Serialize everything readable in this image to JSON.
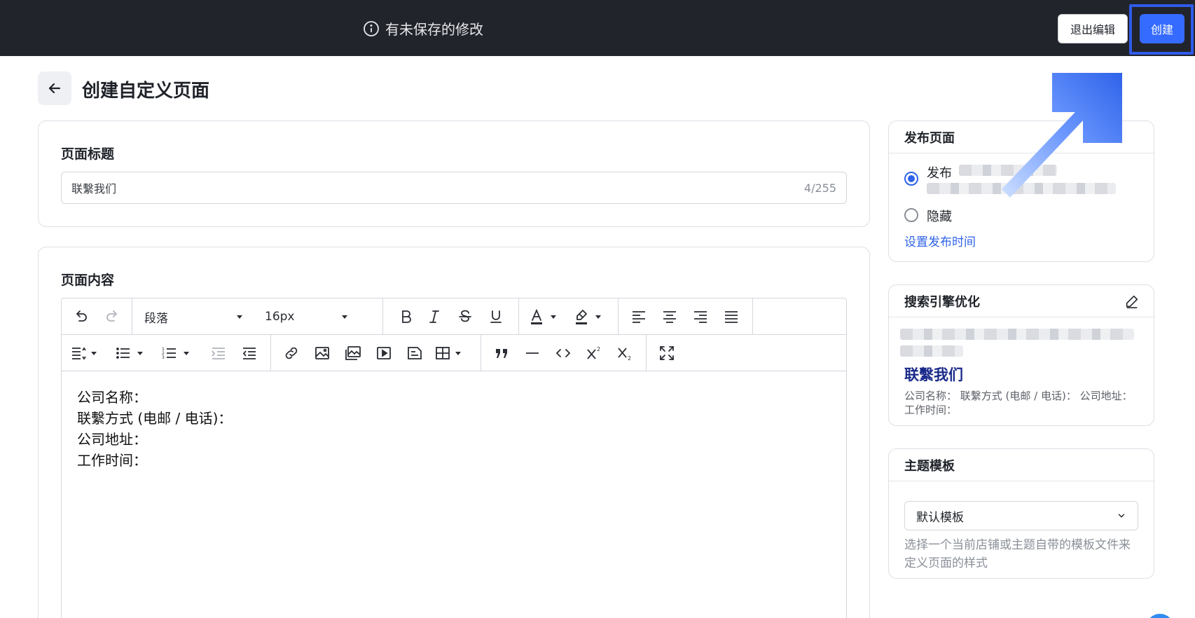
{
  "topbar": {
    "unsaved_text": "有未保存的修改",
    "exit_label": "退出编辑",
    "create_label": "创建"
  },
  "header": {
    "title": "创建自定义页面"
  },
  "title_card": {
    "label": "页面标题",
    "value": "联繫我们",
    "counter": "4/255"
  },
  "content_card": {
    "label": "页面内容",
    "toolbar": {
      "paragraph_select": "段落",
      "fontsize_select": "16px"
    },
    "body_lines": [
      "公司名称：",
      "联繫方式 (电邮 / 电话)：",
      "公司地址：",
      "工作时间："
    ]
  },
  "publish_card": {
    "title": "发布页面",
    "option_publish": "发布",
    "option_hide": "隐藏",
    "schedule_link": "设置发布时间"
  },
  "seo_card": {
    "title": "搜索引擎优化",
    "preview_title": "联繫我们",
    "preview_desc": "公司名称： 联繫方式 (电邮 / 电话)： 公司地址： 工作时间："
  },
  "theme_card": {
    "title": "主题模板",
    "selected": "默认模板",
    "help": "选择一个当前店铺或主题自带的模板文件来定义页面的样式"
  },
  "colors": {
    "topbar_bg": "#22242b",
    "primary": "#356bff",
    "annotation": "#2f5bea"
  }
}
